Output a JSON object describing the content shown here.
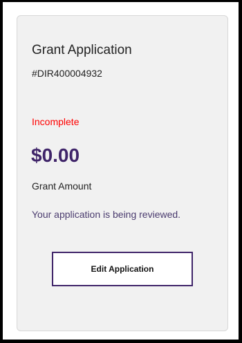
{
  "card": {
    "title": "Grant Application",
    "reference": "#DIR400004932",
    "status": "Incomplete",
    "amount": "$0.00",
    "amount_label": "Grant Amount",
    "review_message": "Your application is being reviewed.",
    "edit_button_label": "Edit Application"
  },
  "colors": {
    "status": "#ff0000",
    "amount": "#3f2469",
    "review_message": "#4a3b6e",
    "button_border": "#3f2469"
  }
}
